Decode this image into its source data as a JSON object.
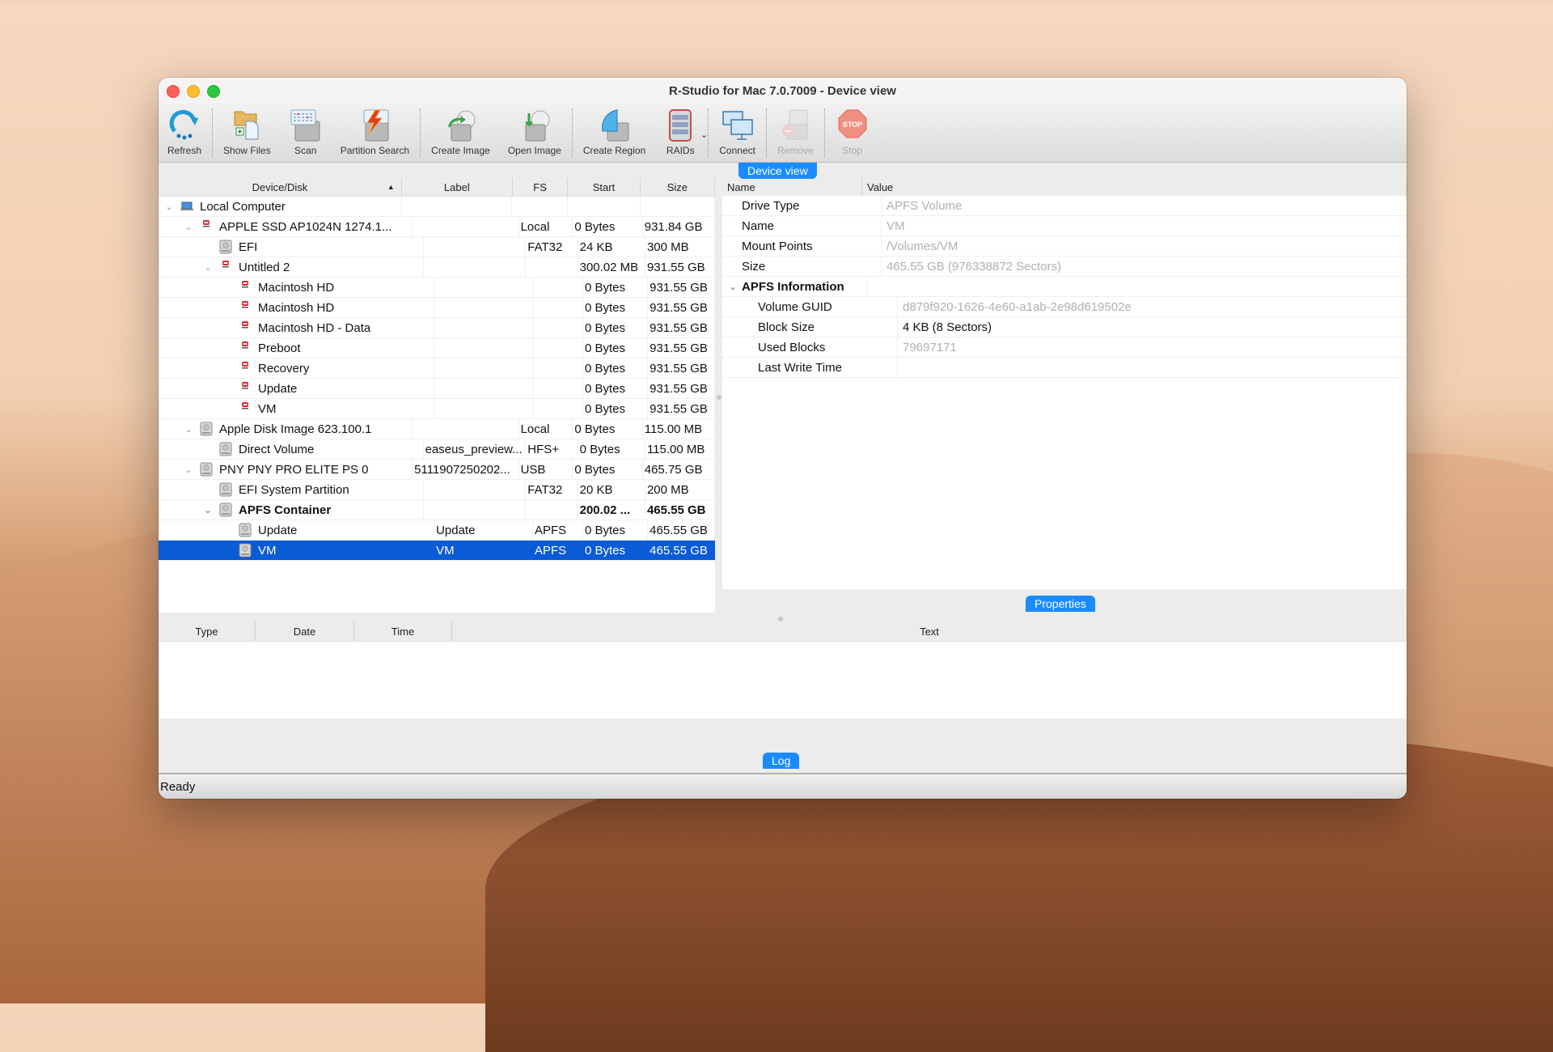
{
  "window": {
    "title": "R-Studio for Mac 7.0.7009 - Device view"
  },
  "toolbar": {
    "buttons": [
      {
        "label": "Refresh",
        "icon": "refresh-icon",
        "enabled": true
      },
      {
        "label": "Show Files",
        "icon": "show-files-icon",
        "enabled": true
      },
      {
        "label": "Scan",
        "icon": "scan-icon",
        "enabled": true
      },
      {
        "label": "Partition Search",
        "icon": "partition-search-icon",
        "enabled": true
      },
      {
        "label": "Create Image",
        "icon": "create-image-icon",
        "enabled": true
      },
      {
        "label": "Open Image",
        "icon": "open-image-icon",
        "enabled": true
      },
      {
        "label": "Create Region",
        "icon": "create-region-icon",
        "enabled": true
      },
      {
        "label": "RAIDs",
        "icon": "raids-icon",
        "enabled": true
      },
      {
        "label": "Connect",
        "icon": "connect-icon",
        "enabled": true
      },
      {
        "label": "Remove",
        "icon": "remove-icon",
        "enabled": false
      },
      {
        "label": "Stop",
        "icon": "stop-icon",
        "enabled": false
      }
    ]
  },
  "device_view": {
    "pane_label": "Device view",
    "columns": [
      "Device/Disk",
      "Label",
      "FS",
      "Start",
      "Size"
    ],
    "sort_column": "Device/Disk",
    "rows": [
      {
        "name": "Local Computer",
        "label": "",
        "fs": "",
        "start": "",
        "size": "",
        "level": 0,
        "expanded": true,
        "icon": "laptop-icon"
      },
      {
        "name": "APPLE SSD AP1024N 1274.1...",
        "label": "",
        "fs": "Local",
        "start": "0 Bytes",
        "size": "931.84 GB",
        "level": 1,
        "expanded": true,
        "icon": "encrypted-disk-icon"
      },
      {
        "name": "EFI",
        "label": "",
        "fs": "FAT32",
        "start": "24 KB",
        "size": "300 MB",
        "level": 2,
        "icon": "disk-icon"
      },
      {
        "name": "Untitled 2",
        "label": "",
        "fs": "",
        "start": "300.02 MB",
        "size": "931.55 GB",
        "level": 2,
        "expanded": true,
        "icon": "encrypted-disk-icon"
      },
      {
        "name": "Macintosh HD",
        "label": "",
        "fs": "",
        "start": "0 Bytes",
        "size": "931.55 GB",
        "level": 3,
        "icon": "encrypted-disk-icon"
      },
      {
        "name": "Macintosh HD",
        "label": "",
        "fs": "",
        "start": "0 Bytes",
        "size": "931.55 GB",
        "level": 3,
        "icon": "encrypted-disk-icon"
      },
      {
        "name": "Macintosh HD - Data",
        "label": "",
        "fs": "",
        "start": "0 Bytes",
        "size": "931.55 GB",
        "level": 3,
        "icon": "encrypted-disk-icon"
      },
      {
        "name": "Preboot",
        "label": "",
        "fs": "",
        "start": "0 Bytes",
        "size": "931.55 GB",
        "level": 3,
        "icon": "encrypted-disk-icon"
      },
      {
        "name": "Recovery",
        "label": "",
        "fs": "",
        "start": "0 Bytes",
        "size": "931.55 GB",
        "level": 3,
        "icon": "encrypted-disk-icon"
      },
      {
        "name": "Update",
        "label": "",
        "fs": "",
        "start": "0 Bytes",
        "size": "931.55 GB",
        "level": 3,
        "icon": "encrypted-disk-icon"
      },
      {
        "name": "VM",
        "label": "",
        "fs": "",
        "start": "0 Bytes",
        "size": "931.55 GB",
        "level": 3,
        "icon": "encrypted-disk-icon"
      },
      {
        "name": "Apple Disk Image 623.100.1",
        "label": "",
        "fs": "Local",
        "start": "0 Bytes",
        "size": "115.00 MB",
        "level": 1,
        "expanded": true,
        "icon": "disk-icon"
      },
      {
        "name": "Direct Volume",
        "label": "easeus_preview...",
        "fs": "HFS+",
        "start": "0 Bytes",
        "size": "115.00 MB",
        "level": 2,
        "icon": "disk-icon"
      },
      {
        "name": "PNY PNY PRO ELITE PS 0",
        "label": "5111907250202...",
        "fs": "USB",
        "start": "0 Bytes",
        "size": "465.75 GB",
        "level": 1,
        "expanded": true,
        "icon": "disk-icon"
      },
      {
        "name": "EFI System Partition",
        "label": "",
        "fs": "FAT32",
        "start": "20 KB",
        "size": "200 MB",
        "level": 2,
        "icon": "disk-icon"
      },
      {
        "name": "APFS Container",
        "label": "",
        "fs": "",
        "start": "200.02 ...",
        "size": "465.55 GB",
        "level": 2,
        "expanded": true,
        "bold": true,
        "icon": "disk-icon"
      },
      {
        "name": "Update",
        "label": "Update",
        "fs": "APFS",
        "start": "0 Bytes",
        "size": "465.55 GB",
        "level": 3,
        "icon": "disk-icon"
      },
      {
        "name": "VM",
        "label": "VM",
        "fs": "APFS",
        "start": "0 Bytes",
        "size": "465.55 GB",
        "level": 3,
        "selected": true,
        "icon": "disk-icon"
      }
    ]
  },
  "properties": {
    "pane_label": "Properties",
    "columns": [
      "Name",
      "Value"
    ],
    "rows": [
      {
        "name": "Drive Type",
        "value": "APFS Volume",
        "level": 1,
        "dim": true
      },
      {
        "name": "Name",
        "value": "VM",
        "level": 1,
        "dim": true
      },
      {
        "name": "Mount Points",
        "value": "/Volumes/VM",
        "level": 1,
        "dim": true
      },
      {
        "name": "Size",
        "value": "465.55 GB (976338872 Sectors)",
        "level": 1,
        "dim": true
      },
      {
        "name": "APFS Information",
        "value": "",
        "level": 0,
        "group": true
      },
      {
        "name": "Volume GUID",
        "value": "d879f920-1626-4e60-a1ab-2e98d619502e",
        "level": 2,
        "dim": true
      },
      {
        "name": "Block Size",
        "value": "4 KB (8 Sectors)",
        "level": 2,
        "dim": false
      },
      {
        "name": "Used Blocks",
        "value": "79697171",
        "level": 2,
        "dim": true
      },
      {
        "name": "Last Write Time",
        "value": "",
        "level": 2,
        "dim": true
      }
    ]
  },
  "log": {
    "pane_label": "Log",
    "columns": [
      "Type",
      "Date",
      "Time",
      "Text"
    ]
  },
  "status": {
    "text": "Ready"
  },
  "colors": {
    "accent": "#1a8cff",
    "selection": "#0a5bd6",
    "encrypted_icon": "#d9262a"
  }
}
